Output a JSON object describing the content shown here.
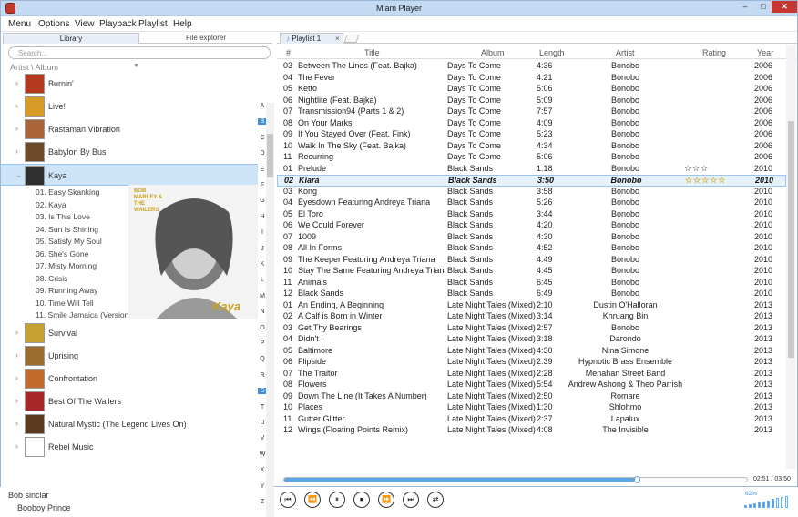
{
  "window": {
    "title": "Miam Player",
    "minimize": "–",
    "maximize": "□",
    "close": "✕"
  },
  "menu": [
    "Menu",
    "Options",
    "View",
    "Playback",
    "Playlist",
    "Help"
  ],
  "library": {
    "tabs": [
      "Library",
      "File explorer"
    ],
    "search_placeholder": "Search...",
    "sort_label": "Artist \\ Album",
    "albums": [
      {
        "label": "Burnin'",
        "color": "#b33a1f"
      },
      {
        "label": "Live!",
        "color": "#d89b28"
      },
      {
        "label": "Rastaman Vibration",
        "color": "#a8653a"
      },
      {
        "label": "Babylon By Bus",
        "color": "#6d4a2a"
      },
      {
        "label": "Kaya",
        "color": "#2f2f2f"
      }
    ],
    "kaya_tracks": [
      "01. Easy Skanking",
      "02. Kaya",
      "03. Is This Love",
      "04. Sun Is Shining",
      "05. Satisfy My Soul",
      "06. She's Gone",
      "07. Misty Morning",
      "08. Crisis",
      "09. Running Away",
      "10. Time Will Tell",
      "11. Smile Jamaica (Version)"
    ],
    "albums_after": [
      {
        "label": "Survival",
        "color": "#c6a030"
      },
      {
        "label": "Uprising",
        "color": "#9a6d2c"
      },
      {
        "label": "Confrontation",
        "color": "#c2692c"
      },
      {
        "label": "Best Of The Wailers",
        "color": "#a7262a"
      },
      {
        "label": "Natural Mystic (The Legend Lives On)",
        "color": "#5a3b20"
      },
      {
        "label": "Rebel Music",
        "color": "#ffffff"
      }
    ],
    "artists": [
      "Bob sinclar",
      "Booboy Prince"
    ],
    "kaya_cover_text": "BOB MARLEY & THE WAILERS",
    "kaya_cover_title": "Kaya",
    "alphabet": [
      "A",
      "B",
      "C",
      "D",
      "E",
      "F",
      "G",
      "H",
      "I",
      "J",
      "K",
      "L",
      "M",
      "N",
      "O",
      "P",
      "Q",
      "R",
      "S",
      "T",
      "U",
      "V",
      "W",
      "X",
      "Y",
      "Z"
    ],
    "alphabet_selected": [
      "B",
      "S"
    ]
  },
  "playlist": {
    "tab": "Playlist 1",
    "tab_close": "×",
    "columns": [
      "#",
      "Title",
      "Album",
      "Length",
      "Artist",
      "Rating",
      "Year"
    ],
    "rows": [
      {
        "n": "03",
        "title": "Between The Lines (Feat. Bajka)",
        "album": "Days To Come",
        "len": "4:36",
        "artist": "Bonobo",
        "rating": "",
        "year": "2006"
      },
      {
        "n": "04",
        "title": "The Fever",
        "album": "Days To Come",
        "len": "4:21",
        "artist": "Bonobo",
        "rating": "",
        "year": "2006"
      },
      {
        "n": "05",
        "title": "Ketto",
        "album": "Days To Come",
        "len": "5:06",
        "artist": "Bonobo",
        "rating": "",
        "year": "2006"
      },
      {
        "n": "06",
        "title": "Nightlite (Feat. Bajka)",
        "album": "Days To Come",
        "len": "5:09",
        "artist": "Bonobo",
        "rating": "",
        "year": "2006"
      },
      {
        "n": "07",
        "title": "Transmission94 (Parts 1 & 2)",
        "album": "Days To Come",
        "len": "7:57",
        "artist": "Bonobo",
        "rating": "",
        "year": "2006"
      },
      {
        "n": "08",
        "title": "On Your Marks",
        "album": "Days To Come",
        "len": "4:09",
        "artist": "Bonobo",
        "rating": "",
        "year": "2006"
      },
      {
        "n": "09",
        "title": "If You Stayed Over (Feat. Fink)",
        "album": "Days To Come",
        "len": "5:23",
        "artist": "Bonobo",
        "rating": "",
        "year": "2006"
      },
      {
        "n": "10",
        "title": "Walk In The Sky (Feat. Bajka)",
        "album": "Days To Come",
        "len": "4:34",
        "artist": "Bonobo",
        "rating": "",
        "year": "2006"
      },
      {
        "n": "11",
        "title": "Recurring",
        "album": "Days To Come",
        "len": "5:06",
        "artist": "Bonobo",
        "rating": "",
        "year": "2006"
      },
      {
        "n": "01",
        "title": "Prelude",
        "album": "Black Sands",
        "len": "1:18",
        "artist": "Bonobo",
        "rating": "☆☆☆",
        "year": "2010"
      },
      {
        "n": "02",
        "title": "Kiara",
        "album": "Black Sands",
        "len": "3:50",
        "artist": "Bonobo",
        "rating": "☆☆☆☆☆",
        "year": "2010",
        "current": true
      },
      {
        "n": "03",
        "title": "Kong",
        "album": "Black Sands",
        "len": "3:58",
        "artist": "Bonobo",
        "rating": "",
        "year": "2010"
      },
      {
        "n": "04",
        "title": "Eyesdown Featuring Andreya Triana",
        "album": "Black Sands",
        "len": "5:26",
        "artist": "Bonobo",
        "rating": "",
        "year": "2010"
      },
      {
        "n": "05",
        "title": "El Toro",
        "album": "Black Sands",
        "len": "3:44",
        "artist": "Bonobo",
        "rating": "",
        "year": "2010"
      },
      {
        "n": "06",
        "title": "We Could Forever",
        "album": "Black Sands",
        "len": "4:20",
        "artist": "Bonobo",
        "rating": "",
        "year": "2010"
      },
      {
        "n": "07",
        "title": "1009",
        "album": "Black Sands",
        "len": "4:30",
        "artist": "Bonobo",
        "rating": "",
        "year": "2010"
      },
      {
        "n": "08",
        "title": "All In Forms",
        "album": "Black Sands",
        "len": "4:52",
        "artist": "Bonobo",
        "rating": "",
        "year": "2010"
      },
      {
        "n": "09",
        "title": "The Keeper Featuring Andreya Triana",
        "album": "Black Sands",
        "len": "4:49",
        "artist": "Bonobo",
        "rating": "",
        "year": "2010"
      },
      {
        "n": "10",
        "title": "Stay The Same Featuring Andreya Triana",
        "album": "Black Sands",
        "len": "4:45",
        "artist": "Bonobo",
        "rating": "",
        "year": "2010"
      },
      {
        "n": "11",
        "title": "Animals",
        "album": "Black Sands",
        "len": "6:45",
        "artist": "Bonobo",
        "rating": "",
        "year": "2010"
      },
      {
        "n": "12",
        "title": "Black Sands",
        "album": "Black Sands",
        "len": "6:49",
        "artist": "Bonobo",
        "rating": "",
        "year": "2010"
      },
      {
        "n": "01",
        "title": "An Ending, A Beginning",
        "album": "Late Night Tales (Mixed)",
        "len": "2:10",
        "artist": "Dustin O'Halloran",
        "rating": "",
        "year": "2013"
      },
      {
        "n": "02",
        "title": "A Calf is Born in Winter",
        "album": "Late Night Tales (Mixed)",
        "len": "3:14",
        "artist": "Khruang Bin",
        "rating": "",
        "year": "2013"
      },
      {
        "n": "03",
        "title": "Get Thy Bearings",
        "album": "Late Night Tales (Mixed)",
        "len": "2:57",
        "artist": "Bonobo",
        "rating": "",
        "year": "2013"
      },
      {
        "n": "04",
        "title": "Didn't I",
        "album": "Late Night Tales (Mixed)",
        "len": "3:18",
        "artist": "Darondo",
        "rating": "",
        "year": "2013"
      },
      {
        "n": "05",
        "title": "Baltimore",
        "album": "Late Night Tales (Mixed)",
        "len": "4:30",
        "artist": "Nina Simone",
        "rating": "",
        "year": "2013"
      },
      {
        "n": "06",
        "title": "Flipside",
        "album": "Late Night Tales (Mixed)",
        "len": "2:39",
        "artist": "Hypnotic Brass Ensemble",
        "rating": "",
        "year": "2013"
      },
      {
        "n": "07",
        "title": "The Traitor",
        "album": "Late Night Tales (Mixed)",
        "len": "2:28",
        "artist": "Menahan Street Band",
        "rating": "",
        "year": "2013"
      },
      {
        "n": "08",
        "title": "Flowers",
        "album": "Late Night Tales (Mixed)",
        "len": "5:54",
        "artist": "Andrew Ashong & Theo Parrish",
        "rating": "",
        "year": "2013"
      },
      {
        "n": "09",
        "title": "Down The Line (It Takes A Number)",
        "album": "Late Night Tales (Mixed)",
        "len": "2:50",
        "artist": "Romare",
        "rating": "",
        "year": "2013"
      },
      {
        "n": "10",
        "title": "Places",
        "album": "Late Night Tales (Mixed)",
        "len": "1:30",
        "artist": "Shlohmo",
        "rating": "",
        "year": "2013"
      },
      {
        "n": "11",
        "title": "Gutter Glitter",
        "album": "Late Night Tales (Mixed)",
        "len": "2:37",
        "artist": "Lapalux",
        "rating": "",
        "year": "2013"
      },
      {
        "n": "12",
        "title": "Wings (Floating Points Remix)",
        "album": "Late Night Tales (Mixed)",
        "len": "4:08",
        "artist": "The Invisible",
        "rating": "",
        "year": "2013"
      }
    ]
  },
  "player": {
    "time": "02:51 / 03:50",
    "progress_fraction": 0.76,
    "volume": "62%",
    "volume_fraction": 0.62,
    "buttons": [
      "⏮",
      "⏪",
      "⏸",
      "⏹",
      "⏩",
      "⏭",
      "⇄"
    ],
    "button_names": [
      "skip-backward",
      "seek-backward",
      "play-pause",
      "stop",
      "seek-forward",
      "skip-forward",
      "playback-mode"
    ],
    "accent": "#3d8ee6"
  }
}
